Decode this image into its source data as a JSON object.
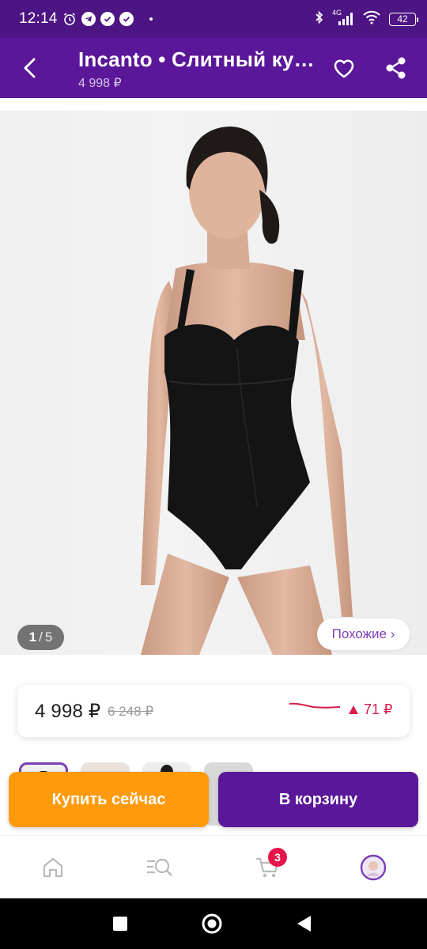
{
  "status_bar": {
    "time": "12:14",
    "network": "4G",
    "battery": "42"
  },
  "app_bar": {
    "title": "Incanto • Слитный купальник",
    "subtitle": "4 998 ₽"
  },
  "gallery": {
    "current": "1",
    "separator": "/",
    "total": "5",
    "similar_label": "Похожие ›"
  },
  "price": {
    "current": "4 998 ₽",
    "old": "6 248 ₽",
    "change": "71 ₽",
    "change_direction": "up",
    "accent": "#d81b4a"
  },
  "actions": {
    "buy_now": "Купить сейчас",
    "add_to_cart": "В корзину"
  },
  "bottom_nav": {
    "items": [
      "home-icon",
      "catalog-search-icon",
      "cart-icon",
      "profile-avatar"
    ],
    "cart_count": "3"
  },
  "colors": {
    "brand": "#5a179a",
    "buy_now": "#ff9a0d",
    "badge": "#e8134b"
  }
}
